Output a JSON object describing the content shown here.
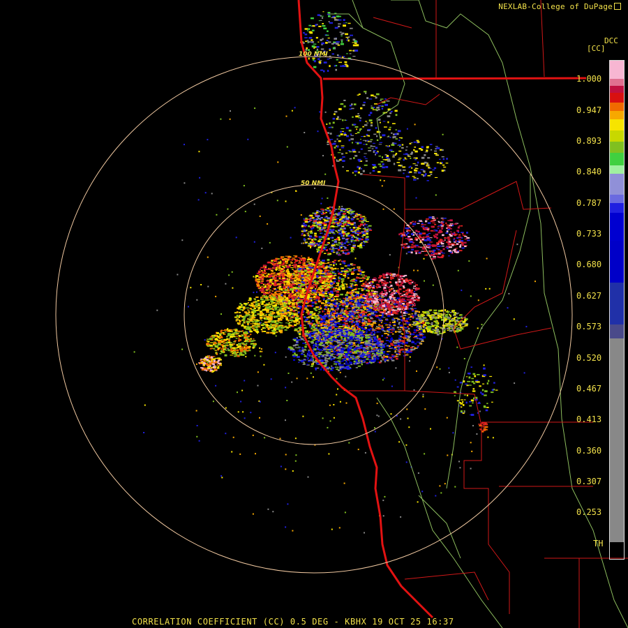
{
  "credit": "NEXLAB-College of DuPage",
  "colorbar": {
    "unit": "[CC]",
    "tag": "DCC",
    "ticks": [
      "1.000",
      "0.947",
      "0.893",
      "0.840",
      "0.787",
      "0.733",
      "0.680",
      "0.627",
      "0.573",
      "0.520",
      "0.467",
      "0.413",
      "0.360",
      "0.307",
      "0.253",
      "TH"
    ]
  },
  "rings": {
    "inner": "50 NMI",
    "outer": "100 NMI"
  },
  "footer": "CORRELATION COEFFICIENT (CC) 0.5 DEG - KBHX 19 OCT 25 16:37",
  "colors": {
    "ring": "#f0c8a0",
    "border": "#d11818",
    "coast": "#e21212",
    "county": "#8dbd5e",
    "text": "#f2e14a"
  }
}
